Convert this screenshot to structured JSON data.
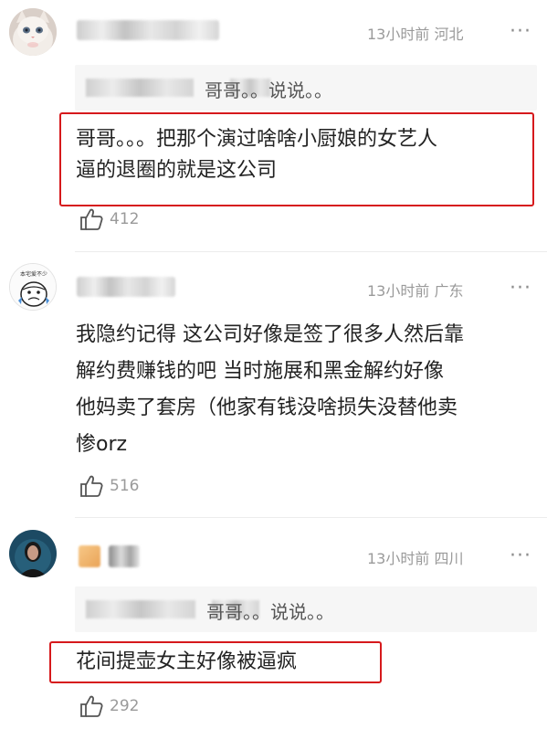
{
  "comments": [
    {
      "time": "13小时前",
      "location": "河北",
      "more": "···",
      "quote_text": "哥哥。。说说。。",
      "body_lines": [
        "哥哥。。。把那个演过啥啥小厨娘的女艺人",
        "逼的退圈的就是这公司"
      ],
      "likes": "412",
      "highlighted": true
    },
    {
      "avatar_label": "本宅爱不少",
      "time": "13小时前",
      "location": "广东",
      "more": "···",
      "body_lines": [
        "我隐约记得 这公司好像是签了很多人然后靠",
        "解约费赚钱的吧 当时施展和黑金解约好像",
        "他妈卖了套房（他家有钱没啥损失没替他卖",
        "惨orz"
      ],
      "likes": "516",
      "highlighted": false
    },
    {
      "time": "13小时前",
      "location": "四川",
      "more": "···",
      "quote_text": "哥哥。。说说。。",
      "body_lines": [
        "花间提壶女主好像被逼疯"
      ],
      "likes": "292",
      "highlighted": true
    }
  ],
  "colors": {
    "highlight_border": "#d6191c",
    "meta_text": "#9a9a9a",
    "quote_bg": "#f6f6f6"
  },
  "icons": [
    "cat-avatar",
    "cartoon-avatar",
    "woman-avatar",
    "thumbs-up-icon",
    "more-options-icon"
  ]
}
